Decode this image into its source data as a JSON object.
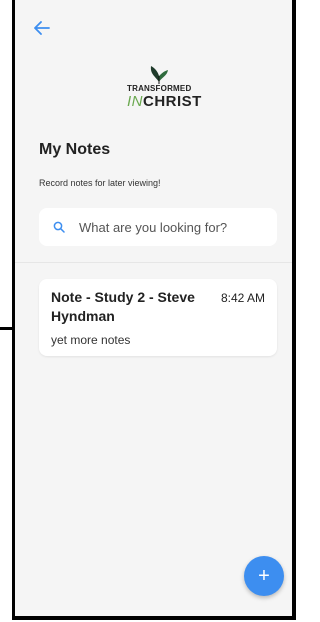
{
  "header": {
    "back_icon": "arrow-left-icon",
    "logo_line1": "TRANSFORMED",
    "logo_line2_prefix": "IN",
    "logo_line2_main": "CHRIST"
  },
  "page": {
    "title": "My Notes",
    "subtitle": "Record notes for later viewing!"
  },
  "search": {
    "placeholder": "What are you looking for?",
    "value": ""
  },
  "notes": [
    {
      "title": "Note - Study 2 - Steve Hyndman",
      "time": "8:42 AM",
      "body": "yet more notes"
    }
  ],
  "fab": {
    "label": "+",
    "icon": "plus-icon"
  },
  "colors": {
    "accent": "#3d8ef0",
    "background": "#f5f5f5",
    "logo_green": "#6aa84f"
  }
}
